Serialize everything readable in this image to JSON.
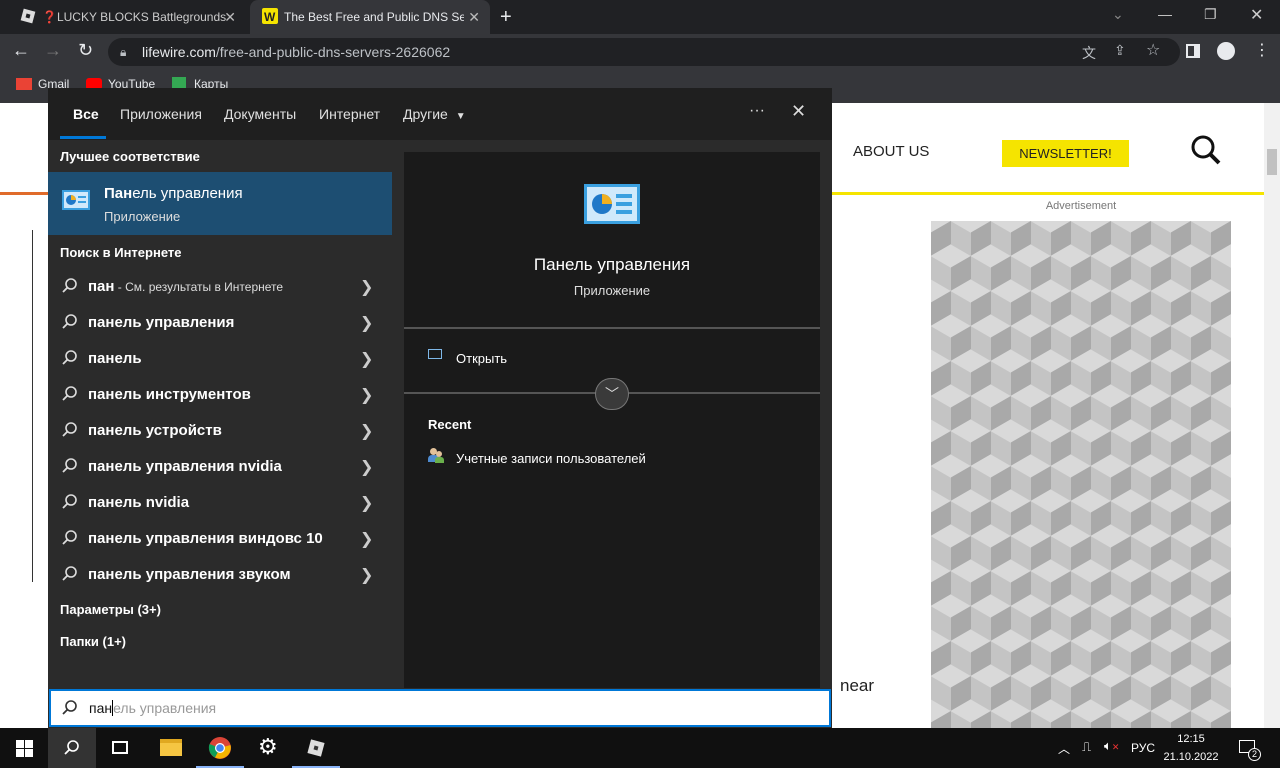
{
  "browser": {
    "tabs": [
      {
        "title": "❓LUCKY BLOCKS Battlegrounds",
        "active": false
      },
      {
        "title": "The Best Free and Public DNS Se",
        "active": true
      }
    ],
    "url_domain": "lifewire.com",
    "url_path": "/free-and-public-dns-servers-2626062",
    "bookmarks": [
      "Gmail",
      "YouTube",
      "Карты"
    ]
  },
  "page": {
    "nav_about": "ABOUT US",
    "newsletter": "NEWSLETTER!",
    "ad_label": "Advertisement",
    "body_fragment": "near",
    "accent_color": "#f5e400"
  },
  "start_search": {
    "tabs": [
      "Все",
      "Приложения",
      "Документы",
      "Интернет",
      "Другие"
    ],
    "more_label": "···",
    "best_match_header": "Лучшее соответствие",
    "best_match": {
      "title_bold": "Пан",
      "title_rest": "ель управления",
      "subtitle": "Приложение"
    },
    "web_header": "Поиск в Интернете",
    "web_results": [
      {
        "bold": "пан",
        "rest": " - См. результаты в Интернете"
      },
      {
        "bold": "панель управления",
        "rest": ""
      },
      {
        "bold": "панель",
        "rest": ""
      },
      {
        "bold": "панель инструментов",
        "rest": ""
      },
      {
        "bold": "панель устройств",
        "rest": ""
      },
      {
        "bold": "панель управления nvidia",
        "rest": ""
      },
      {
        "bold": "панель nvidia",
        "rest": ""
      },
      {
        "bold": "панель управления виндовс 10",
        "rest": ""
      },
      {
        "bold": "панель управления звуком",
        "rest": ""
      }
    ],
    "settings_header": "Параметры (3+)",
    "folders_header": "Папки (1+)",
    "preview": {
      "title": "Панель управления",
      "subtitle": "Приложение",
      "open_action": "Открыть",
      "recent_header": "Recent",
      "recent_items": [
        "Учетные записи пользователей"
      ]
    },
    "query_typed": "пан",
    "query_suggestion": "ель управления",
    "accent": "#0078d7"
  },
  "taskbar": {
    "language": "РУС",
    "time": "12:15",
    "date": "21.10.2022",
    "notifications": "2"
  }
}
